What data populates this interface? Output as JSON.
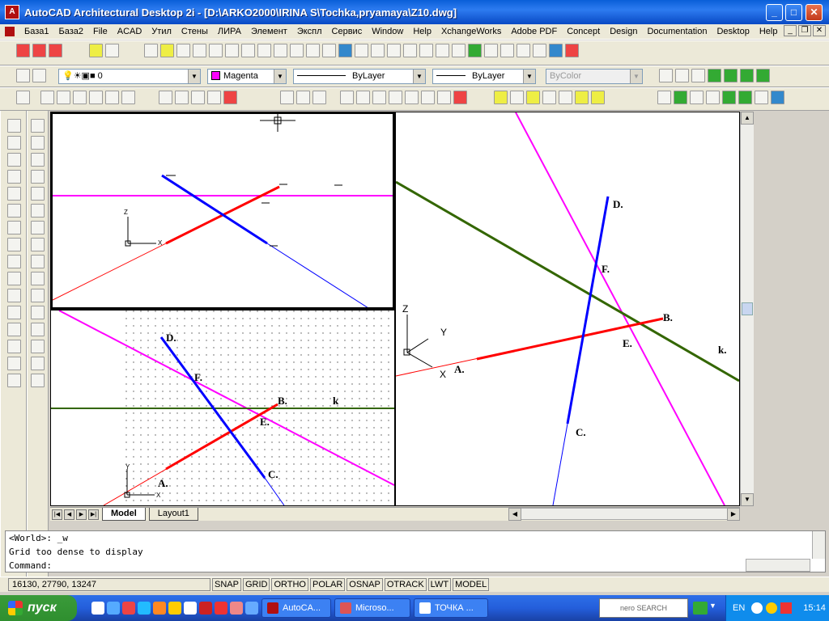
{
  "window": {
    "title": "AutoCAD Architectural Desktop 2i - [D:\\ARKO2000\\IRINA S\\Tochka,pryamaya\\Z10.dwg]"
  },
  "menu": [
    "База1",
    "База2",
    "File",
    "ACAD",
    "Утил",
    "Стены",
    "ЛИРА",
    "Элемент",
    "Экспл",
    "Сервис",
    "Window",
    "Help",
    "XchangeWorks",
    "Adobe PDF",
    "Concept",
    "Design",
    "Documentation",
    "Desktop",
    "Help"
  ],
  "properties": {
    "layer": "0",
    "color": "Magenta",
    "linetype": "ByLayer",
    "lineweight": "ByLayer",
    "plotstyle": "ByColor"
  },
  "colors": {
    "magenta": "#ff00ff",
    "red": "#ff0000",
    "blue": "#0000ff",
    "green": "#336600"
  },
  "viewports": {
    "top_left": {
      "axis_z": "Z",
      "axis_x": "X"
    },
    "bottom_left": {
      "labels": {
        "D": "D.",
        "F": "F.",
        "B": "B.",
        "k": "k",
        "E": "E.",
        "A": "A.",
        "C": "C."
      },
      "axis_y": "Y",
      "axis_x": "X"
    },
    "right": {
      "labels": {
        "D": "D.",
        "F": "F.",
        "B": "B.",
        "E": "E.",
        "k": "k.",
        "A": "A.",
        "C": "C."
      },
      "axis_z": "Z",
      "axis_y": "Y",
      "axis_x": "X"
    }
  },
  "tabs": {
    "model": "Model",
    "layout": "Layout1"
  },
  "command": {
    "line1": "<World>: _w",
    "line2": "Grid too dense to display",
    "prompt": "Command:"
  },
  "status": {
    "coords": "16130, 27790, 13247",
    "toggles": [
      "SNAP",
      "GRID",
      "ORTHO",
      "POLAR",
      "OSNAP",
      "OTRACK",
      "LWT",
      "MODEL"
    ]
  },
  "taskbar": {
    "start": "пуск",
    "buttons": [
      "AutoCA...",
      "Microso...",
      "ТОЧКА ..."
    ],
    "search": "nero SEARCH",
    "lang": "EN",
    "time": "15:14"
  }
}
